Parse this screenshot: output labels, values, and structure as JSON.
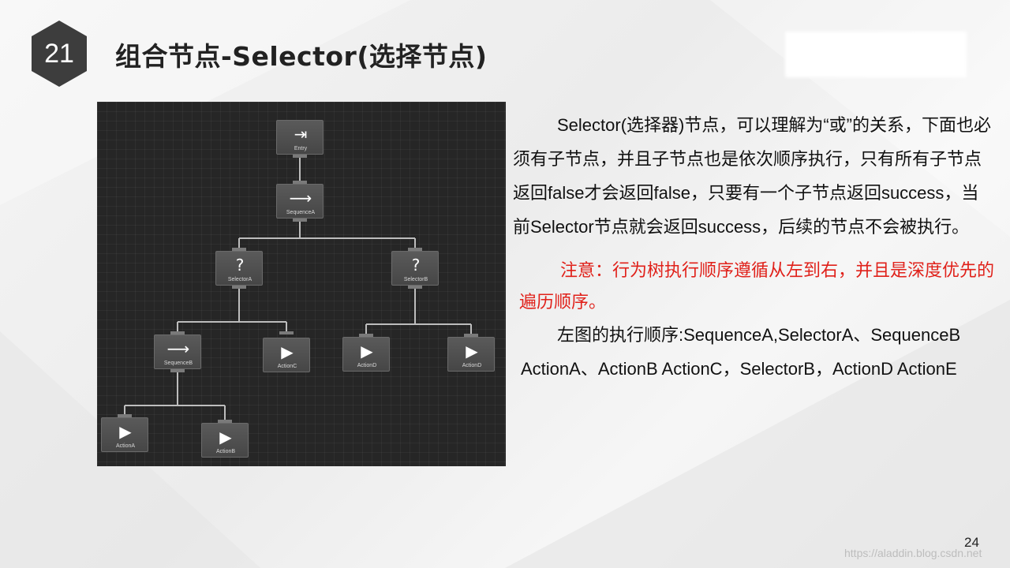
{
  "slide": {
    "number": "21",
    "title": "组合节点-Selector(选择节点)",
    "page_number": "24",
    "watermark": "https://aladdin.blog.csdn.net"
  },
  "tree": {
    "nodes": {
      "entry": "Entry",
      "sequence_a": "SequenceA",
      "selector_a": "SelectorA",
      "selector_b": "SelectorB",
      "sequence_b": "SequenceB",
      "action_c": "ActionC",
      "action_d1": "ActionD",
      "action_d2": "ActionD",
      "action_a": "ActionA",
      "action_b": "ActionB"
    },
    "icons": {
      "entry": "entry-icon",
      "sequence": "arrow-right-icon",
      "selector": "question-mark-icon",
      "action": "play-icon"
    }
  },
  "text": {
    "paragraph1": "Selector(选择器)节点，可以理解为“或”的关系，下面也必须有子节点，并且子节点也是依次顺序执行，只有所有子节点返回false才会返回false，只要有一个子节点返回success，当前Selector节点就会返回success，后续的节点不会被执行。",
    "note": "注意：行为树执行顺序遵循从左到右，并且是深度优先的遍历顺序。",
    "order": "左图的执行顺序:SequenceA,SelectorA、SequenceB ActionA、ActionB ActionC，SelectorB，ActionD ActionE"
  },
  "colors": {
    "badge": "#3d3d3d",
    "note": "#e0211a",
    "panel_bg": "#262626",
    "node_bg": "#505050"
  }
}
